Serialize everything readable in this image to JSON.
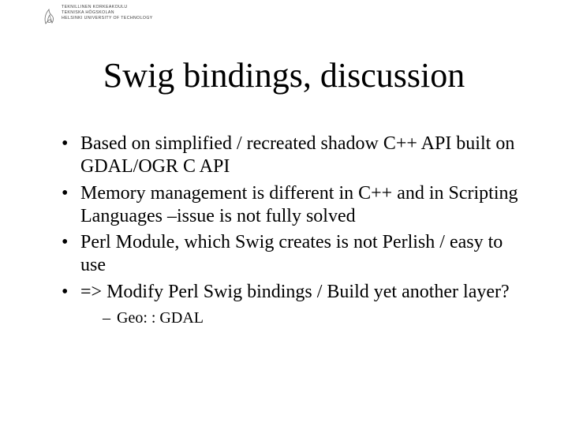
{
  "logo": {
    "line1": "TEKNILLINEN KORKEAKOULU",
    "line2": "TEKNISKA HÖGSKOLAN",
    "line3": "HELSINKI UNIVERSITY OF TECHNOLOGY"
  },
  "title": "Swig bindings, discussion",
  "bullets": [
    "Based on simplified / recreated shadow C++ API built on GDAL/OGR C API",
    "Memory management is different in C++ and in Scripting Languages –issue is not fully solved",
    "Perl Module, which Swig creates is not Perlish / easy to use",
    "=> Modify Perl Swig bindings / Build yet another layer?"
  ],
  "sub_bullets_of_last": [
    "Geo: : GDAL"
  ]
}
